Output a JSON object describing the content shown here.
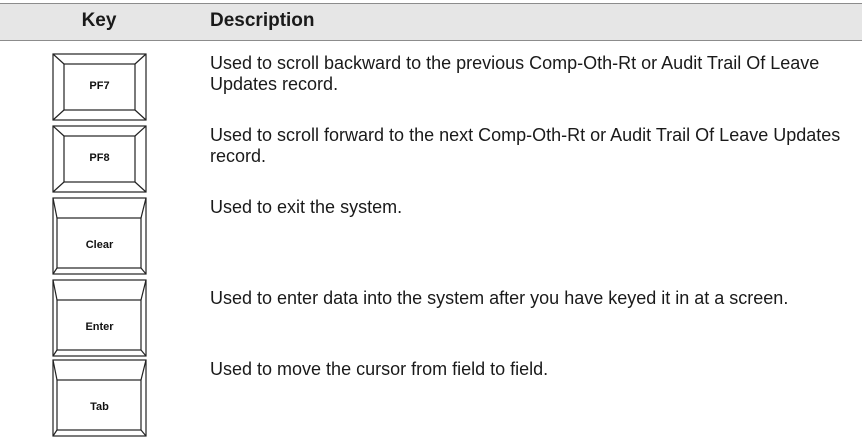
{
  "table": {
    "header": {
      "key": "Key",
      "description": "Description"
    },
    "rows": [
      {
        "key_label": "PF7",
        "description": "Used to scroll backward to the previous Comp-Oth-Rt or Audit Trail Of Leave Updates record."
      },
      {
        "key_label": "PF8",
        "description": "Used to scroll forward to the next Comp-Oth-Rt or Audit Trail Of Leave Updates record."
      },
      {
        "key_label": "Clear",
        "description": "Used to exit the system."
      },
      {
        "key_label": "Enter",
        "description": "Used to enter data into the system after you have keyed it in at a screen."
      },
      {
        "key_label": "Tab",
        "description": "Used to move the cursor from field to field."
      }
    ]
  }
}
